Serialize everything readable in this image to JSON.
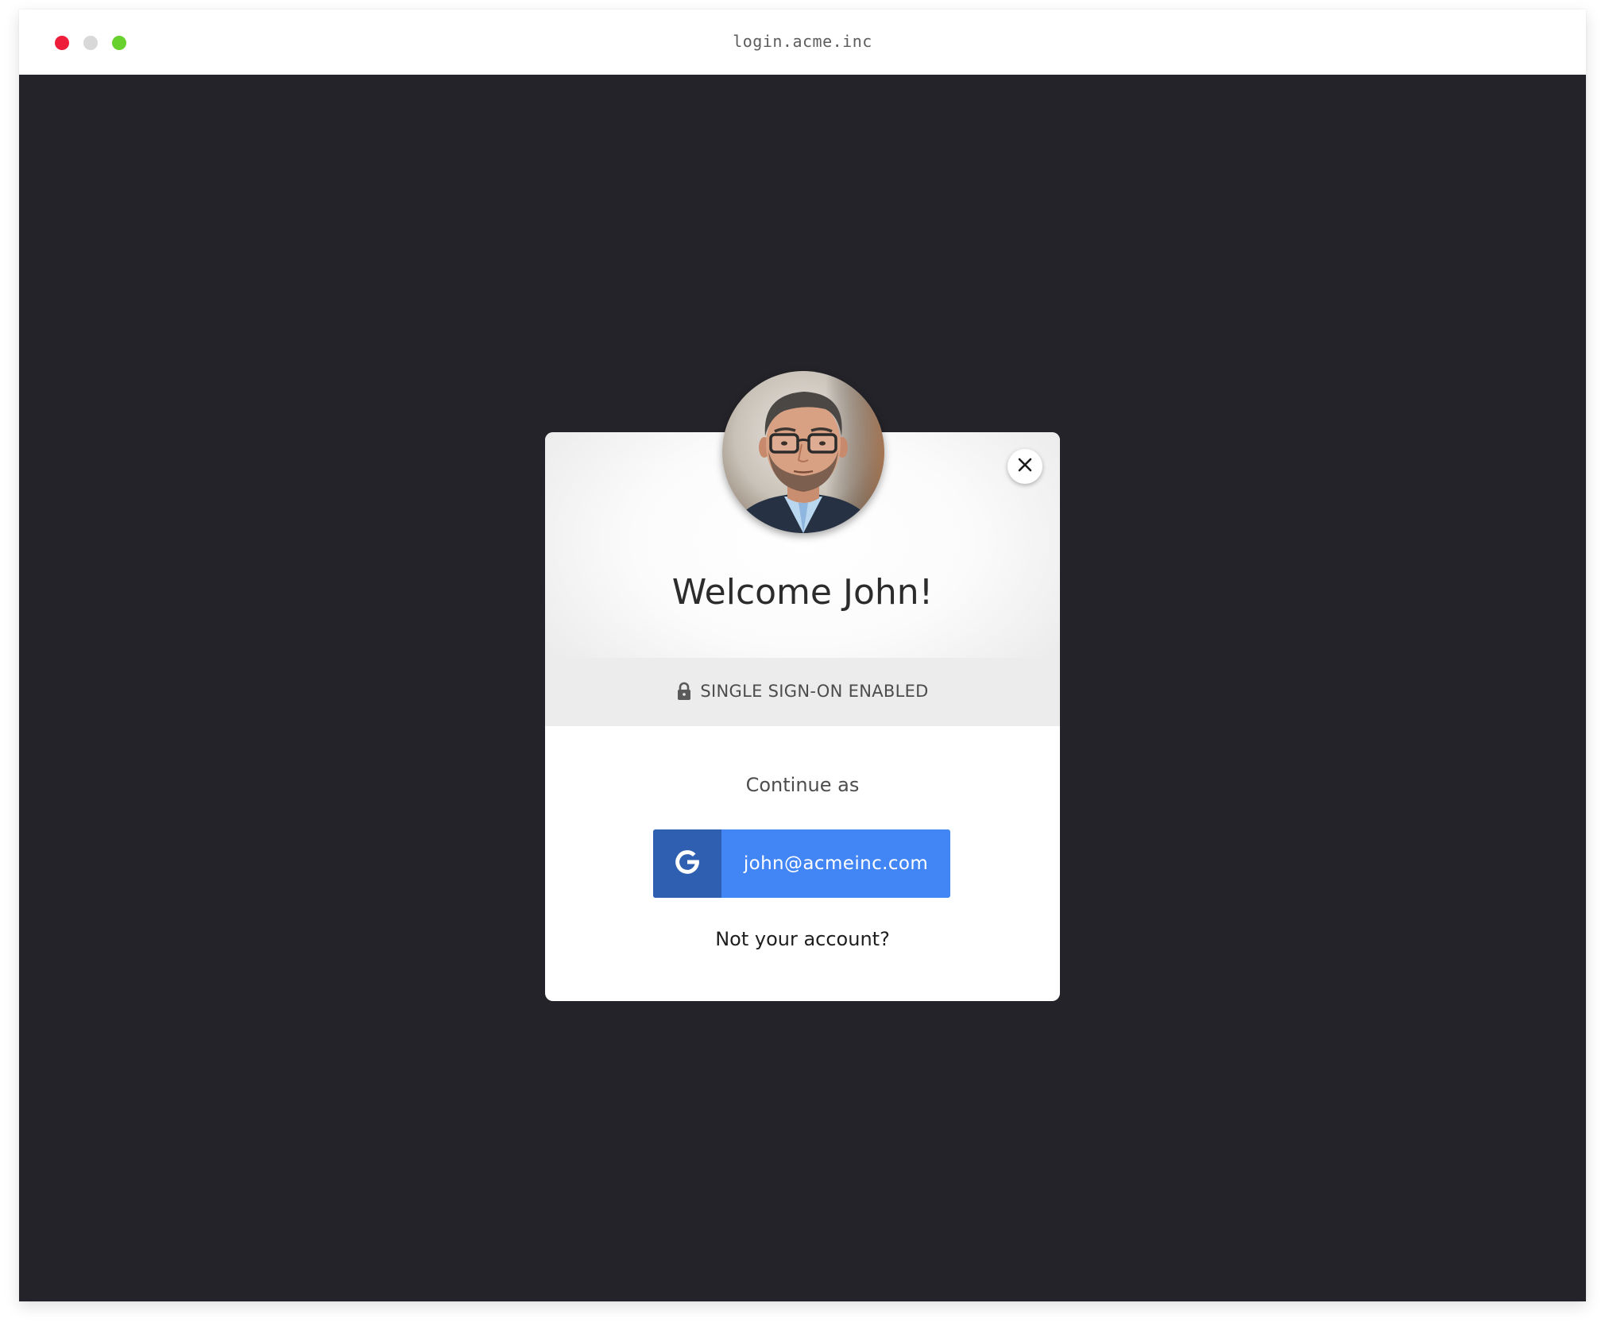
{
  "window": {
    "url": "login.acme.inc"
  },
  "modal": {
    "welcome": "Welcome John!",
    "sso_label": "SINGLE SIGN-ON ENABLED",
    "continue_label": "Continue as",
    "google_account_email": "john@acmeinc.com",
    "not_account_link": "Not your account?"
  },
  "icons": {
    "lock": "lock-icon",
    "close": "close-icon",
    "google": "google-g-icon"
  },
  "colors": {
    "page_background": "#232329",
    "google_blue": "#4285f4",
    "google_dark_blue": "#2f5fb0",
    "traffic_red": "#ee1d3a",
    "traffic_gray": "#d8d8d8",
    "traffic_green": "#69d12d"
  }
}
